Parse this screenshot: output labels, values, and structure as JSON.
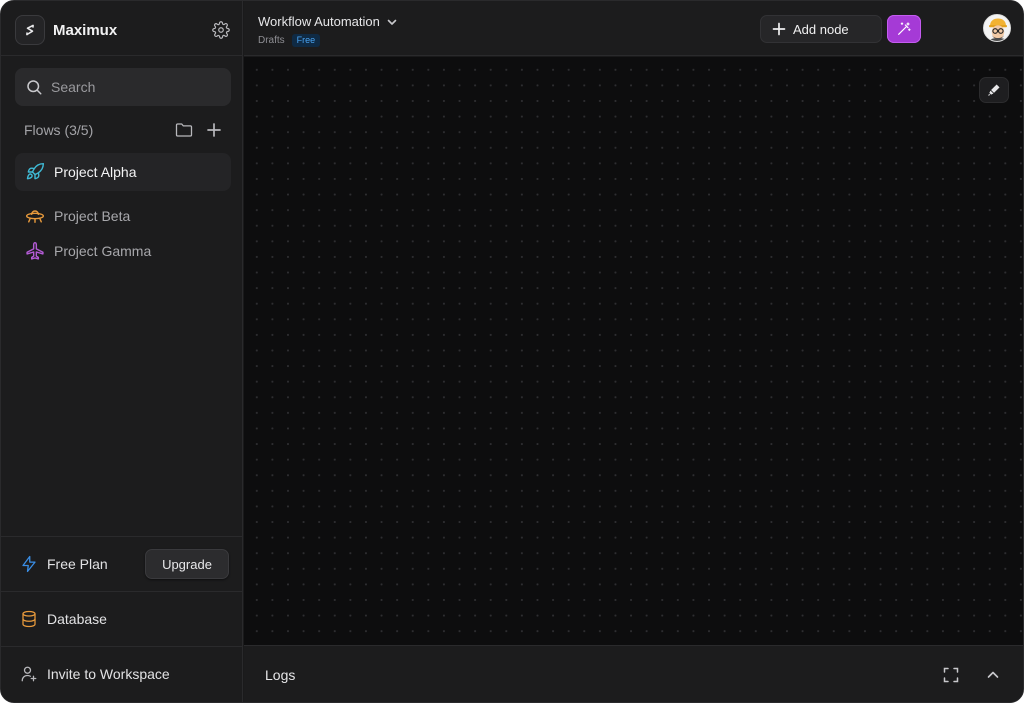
{
  "app": {
    "name": "Maximux",
    "icons": {
      "logo": "logo-icon",
      "settings": "gear-icon"
    }
  },
  "sidebar": {
    "search": {
      "placeholder": "Search",
      "icon": "search-icon"
    },
    "flows": {
      "title": "Flows (3/5)",
      "actions": [
        {
          "icon": "folder-icon"
        },
        {
          "icon": "plus-icon"
        }
      ],
      "items": [
        {
          "label": "Project Alpha",
          "icon": "rocket-icon",
          "color": "#3fb9d4",
          "active": true
        },
        {
          "label": "Project Beta",
          "icon": "ufo-icon",
          "color": "#e89a3c",
          "active": false
        },
        {
          "label": "Project Gamma",
          "icon": "plane-icon",
          "color": "#b45bd6",
          "active": false
        }
      ]
    },
    "plan": {
      "label": "Free Plan",
      "icon": "lightning-icon",
      "color": "#3a8ee6",
      "upgrade_label": "Upgrade"
    },
    "database": {
      "label": "Database",
      "icon": "database-icon",
      "color": "#e89a3c"
    },
    "invite": {
      "label": "Invite to Workspace",
      "icon": "user-plus-icon"
    }
  },
  "header": {
    "workflow_title": "Workflow Automation",
    "breadcrumb": "Drafts",
    "badge": "Free",
    "add_node_label": "Add node",
    "magic_icon": "magic-wand-icon",
    "accent": "#a53ad6"
  },
  "canvas": {
    "tool_icon": "pen-icon"
  },
  "logs": {
    "title": "Logs",
    "icons": [
      "expand-icon",
      "chevron-up-icon"
    ]
  }
}
